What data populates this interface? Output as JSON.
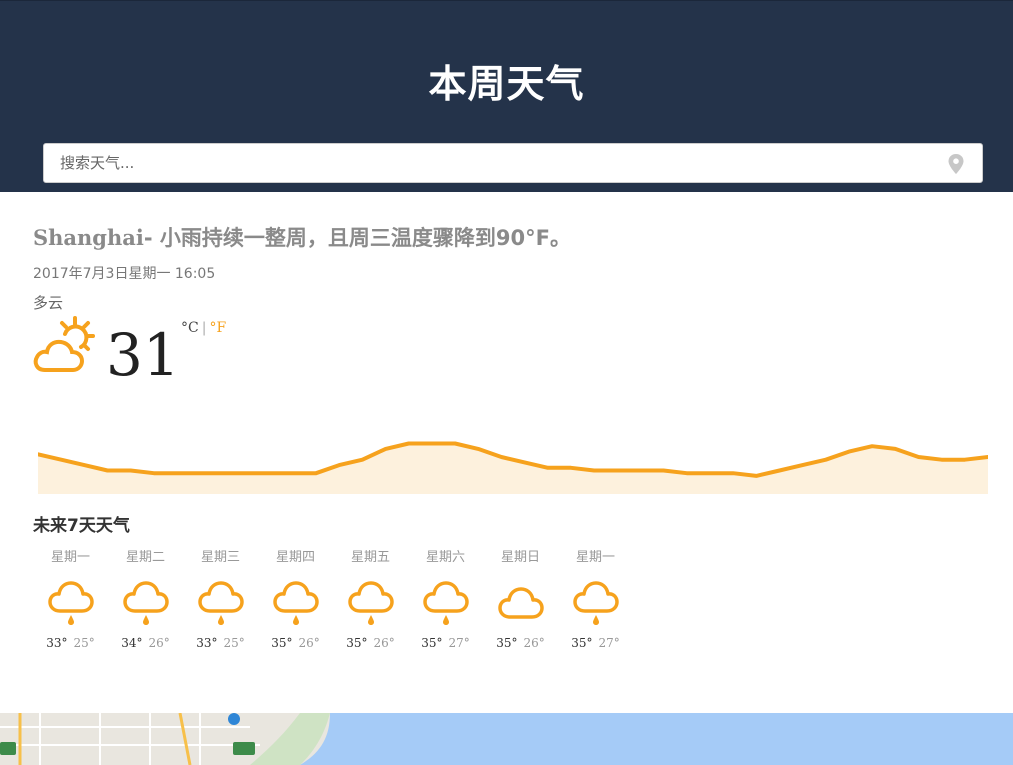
{
  "header": {
    "title": "本周天气",
    "search_placeholder": "搜索天气..."
  },
  "current": {
    "city": "Shanghai",
    "headline_summary": "- 小雨持续一整周，且周三温度骤降到90°F。",
    "datetime": "2017年7月3日星期一 16:05",
    "condition": "多云",
    "icon": "partly-cloudy-icon",
    "temperature": "31",
    "unit_c": "°C",
    "unit_separator": "|",
    "unit_f": "°F"
  },
  "forecast": {
    "title": "未来7天天气",
    "days": [
      {
        "name": "星期一",
        "icon": "rain-icon",
        "high": "33°",
        "low": "25°"
      },
      {
        "name": "星期二",
        "icon": "rain-icon",
        "high": "34°",
        "low": "26°"
      },
      {
        "name": "星期三",
        "icon": "rain-icon",
        "high": "33°",
        "low": "25°"
      },
      {
        "name": "星期四",
        "icon": "rain-icon",
        "high": "35°",
        "low": "26°"
      },
      {
        "name": "星期五",
        "icon": "rain-icon",
        "high": "35°",
        "low": "26°"
      },
      {
        "name": "星期六",
        "icon": "rain-icon",
        "high": "35°",
        "low": "27°"
      },
      {
        "name": "星期日",
        "icon": "cloud-icon",
        "high": "35°",
        "low": "26°"
      },
      {
        "name": "星期一",
        "icon": "rain-icon",
        "high": "35°",
        "low": "27°"
      }
    ]
  },
  "chart_data": {
    "type": "area",
    "series": [
      {
        "values": [
          30.2,
          29.8,
          29.4,
          29.0,
          29.0,
          28.8,
          28.8,
          28.8,
          28.8,
          28.8,
          28.8,
          28.8,
          28.8,
          29.4,
          29.8,
          30.6,
          31.0,
          31.0,
          31.0,
          30.6,
          30.0,
          29.6,
          29.2,
          29.2,
          29.0,
          29.0,
          29.0,
          29.0,
          28.8,
          28.8,
          28.8,
          28.6,
          29.0,
          29.4,
          29.8,
          30.4,
          30.8,
          30.6,
          30.0,
          29.8,
          29.8,
          30.0
        ]
      }
    ],
    "ylim": [
      28,
      32
    ],
    "grid": false,
    "line_color": "#f6a21d",
    "fill_color": "#fdf1dd"
  },
  "colors": {
    "header_bg": "#24334a",
    "accent": "#f6a21d",
    "map_water": "#a5cbf7"
  }
}
